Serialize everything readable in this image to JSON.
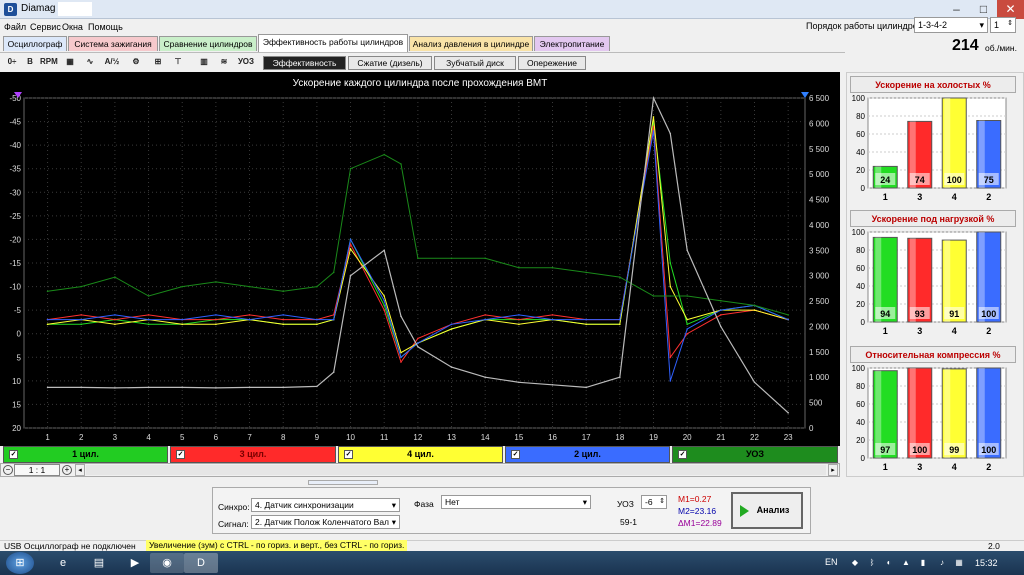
{
  "window": {
    "title": "Diamag 2",
    "app_icon": "diamag-icon"
  },
  "menu": [
    "Файл",
    "Сервис",
    "Окна",
    "Помощь"
  ],
  "cylinder_order": {
    "label": "Порядок работы цилиндров",
    "value": "1-3-4-2",
    "count": "1"
  },
  "tabs": [
    {
      "label": "Осциллограф",
      "color": "#dce8fa"
    },
    {
      "label": "Система зажигания",
      "color": "#f6c9cc"
    },
    {
      "label": "Сравнение цилиндров",
      "color": "#c9efc9"
    },
    {
      "label": "Эффективность работы цилиндров",
      "color": "#ffffff"
    },
    {
      "label": "Анализ давления в цилиндре",
      "color": "#f9e3a8"
    },
    {
      "label": "Электропитание",
      "color": "#e3c8f0"
    }
  ],
  "rpm": {
    "value": "214",
    "unit": "об./мин."
  },
  "toolbar_icons": [
    "0-icon",
    "bold-b-icon",
    "rpm-icon",
    "grid-icon",
    "line-icon",
    "abc-icon",
    "calc-icon",
    "bars-icon",
    "filter-icon",
    "chart-icon",
    "waveform-icon",
    "uoz-icon",
    "export-icon"
  ],
  "toolbar_icon_glyphs": [
    "0÷",
    "B",
    "RPM",
    "▦",
    "∿",
    "A/½",
    "⚙",
    "⊞",
    "⊤",
    "▥",
    "≋",
    "УОЗ",
    "↗"
  ],
  "subtabs": [
    "Эффективность",
    "Сжатие (дизель)",
    "Зубчатый диск",
    "Опережение"
  ],
  "chart": {
    "title": "Ускорение каждого цилиндра после прохождения ВМТ",
    "left_ticks": [
      "-50",
      "-45",
      "-40",
      "-35",
      "-30",
      "-25",
      "-20",
      "-15",
      "-10",
      "-5",
      "0",
      "5",
      "10",
      "15",
      "20"
    ],
    "right_ticks": [
      "6 500",
      "6 000",
      "5 500",
      "5 000",
      "4 500",
      "4 000",
      "3 500",
      "3 000",
      "2 500",
      "2 000",
      "1 500",
      "1 000",
      "500",
      "0"
    ],
    "x_ticks": [
      "1",
      "2",
      "3",
      "4",
      "5",
      "6",
      "7",
      "8",
      "9",
      "10",
      "11",
      "12",
      "13",
      "14",
      "15",
      "16",
      "17",
      "18",
      "19",
      "20",
      "21",
      "22",
      "23"
    ]
  },
  "chart_data": {
    "type": "line",
    "title": "Ускорение каждого цилиндра после прохождения ВМТ",
    "xlim": [
      0.3,
      23.5
    ],
    "ylim_left": [
      -50,
      20
    ],
    "ylim_right": [
      0,
      6500
    ],
    "x": [
      1,
      2,
      3,
      4,
      5,
      6,
      7,
      8,
      9,
      9.5,
      10,
      11,
      11.5,
      12,
      13,
      14,
      15,
      16,
      17,
      18,
      19,
      19.5,
      20,
      21,
      22,
      23
    ],
    "series": [
      {
        "name": "1 цил.",
        "color": "#22dd22",
        "axis": "left",
        "values": [
          -2,
          -2,
          -3,
          -2,
          -2,
          -3,
          -3,
          -2,
          -2,
          -3,
          -20,
          -6,
          5,
          2,
          -1,
          -3,
          -3,
          -3,
          -2,
          -2,
          -45,
          -15,
          -2,
          -5,
          -6,
          -3
        ]
      },
      {
        "name": "3 цил.",
        "color": "#ff3030",
        "axis": "left",
        "values": [
          -3,
          -4,
          -3,
          -4,
          -3,
          -3,
          -4,
          -3,
          -3,
          -4,
          -19,
          -5,
          6,
          1,
          -2,
          -4,
          -3,
          -4,
          -3,
          -3,
          -44,
          5,
          0,
          -4,
          -5,
          -3
        ]
      },
      {
        "name": "4 цил.",
        "color": "#ffff33",
        "axis": "left",
        "values": [
          -2,
          -3,
          -2,
          -3,
          -2,
          -2,
          -3,
          -2,
          -2,
          -3,
          -18,
          -8,
          4,
          2,
          -1,
          -3,
          -2,
          -3,
          -2,
          -2,
          -46,
          -10,
          -3,
          -5,
          -5,
          -3
        ]
      },
      {
        "name": "2 цил.",
        "color": "#3060ff",
        "axis": "left",
        "values": [
          -3,
          -3,
          -4,
          -3,
          -3,
          -4,
          -3,
          -4,
          -3,
          -3,
          -20,
          -7,
          5,
          2,
          -2,
          -3,
          -4,
          -3,
          -3,
          -3,
          -43,
          10,
          -1,
          -5,
          -6,
          -3
        ]
      },
      {
        "name": "УОЗ",
        "color": "#1a8a1a",
        "axis": "left",
        "values": [
          -9,
          -10,
          -12,
          -8,
          -10,
          -11,
          -10,
          -9,
          -10,
          -13,
          -35,
          -38,
          -36,
          -16,
          -16,
          -16,
          -14,
          -14,
          -13,
          -12,
          -8,
          -8,
          -8,
          -7,
          -6,
          -4
        ]
      },
      {
        "name": "RPM",
        "color": "#bbbbbb",
        "axis": "right",
        "values": [
          800,
          800,
          790,
          800,
          800,
          790,
          800,
          800,
          820,
          1100,
          3000,
          3500,
          2200,
          1600,
          1200,
          1000,
          900,
          850,
          800,
          1000,
          6500,
          5800,
          3500,
          2000,
          900,
          300
        ]
      }
    ]
  },
  "channels": [
    {
      "label": "1 цил.",
      "color": "#22cc22",
      "text": "#000"
    },
    {
      "label": "3 цил.",
      "color": "#ff2a2a",
      "text": "#7a0000"
    },
    {
      "label": "4 цил.",
      "color": "#ffff33",
      "text": "#000"
    },
    {
      "label": "2 цил.",
      "color": "#3a6cff",
      "text": "#000"
    },
    {
      "label": "УОЗ",
      "color": "#1e8c1e",
      "text": "#000"
    }
  ],
  "scale": {
    "value": "1 : 1"
  },
  "panels": [
    {
      "title": "Ускорение на холостых %",
      "categories": [
        "1",
        "3",
        "4",
        "2"
      ],
      "values": [
        24,
        74,
        100,
        75
      ]
    },
    {
      "title": "Ускорение под нагрузкой %",
      "categories": [
        "1",
        "3",
        "4",
        "2"
      ],
      "values": [
        94,
        93,
        91,
        100
      ]
    },
    {
      "title": "Относительная компрессия %",
      "categories": [
        "1",
        "3",
        "4",
        "2"
      ],
      "values": [
        97,
        100,
        99,
        100
      ]
    }
  ],
  "panel_y_ticks": [
    "100",
    "80",
    "60",
    "40",
    "20",
    "0"
  ],
  "bar_colors": [
    "#22dd22",
    "#ff2a2a",
    "#ffff33",
    "#3a6cff"
  ],
  "settings": {
    "sync_label": "Синхро:",
    "sync_value": "4. Датчик синхронизации",
    "signal_label": "Сигнал:",
    "signal_value": "2. Датчик Полож Коленчатого Вал",
    "phase_label": "Фаза",
    "phase_value": "Нет",
    "uoz_label": "УОЗ",
    "uoz_value": "-6",
    "tooth_label": "59-1",
    "m1": "M1=0.27",
    "m2": "M2=23.16",
    "dm1": "ΔM1=22.89",
    "analyze_label": "Анализ"
  },
  "status": {
    "left": "USB Осциллограф не подключен",
    "hint": "Увеличение (зум) с CTRL - по гориз. и верт., без CTRL - по гориз.",
    "right": "2.0"
  },
  "taskbar": {
    "lang": "EN",
    "time": "15:32"
  }
}
